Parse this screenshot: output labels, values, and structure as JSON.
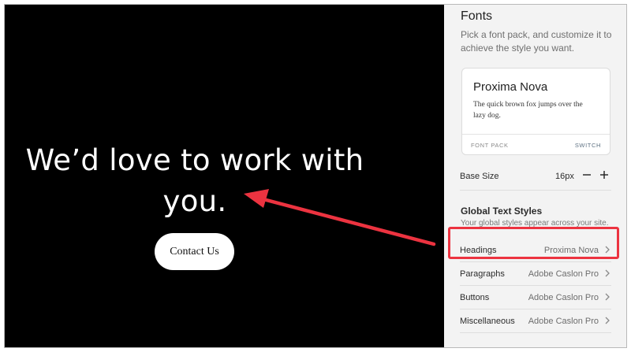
{
  "preview": {
    "heading_line1": "We’d love to work with",
    "heading_line2": "you.",
    "cta_label": "Contact Us"
  },
  "panel": {
    "title": "Fonts",
    "description": "Pick a font pack, and customize it to achieve the style you want.",
    "font_pack": {
      "name": "Proxima Nova",
      "sample": "The quick brown fox jumps over the lazy dog.",
      "label": "FONT PACK",
      "switch_label": "SWITCH"
    },
    "base_size": {
      "label": "Base Size",
      "value": "16px",
      "decrement_icon": "minus-icon",
      "increment_icon": "plus-icon"
    },
    "global_styles": {
      "title": "Global Text Styles",
      "subtitle": "Your global styles appear across your site.",
      "rows": [
        {
          "label": "Headings",
          "value": "Proxima Nova"
        },
        {
          "label": "Paragraphs",
          "value": "Adobe Caslon Pro"
        },
        {
          "label": "Buttons",
          "value": "Adobe Caslon Pro"
        },
        {
          "label": "Miscellaneous",
          "value": "Adobe Caslon Pro"
        }
      ]
    }
  },
  "annotation": {
    "color": "#ec3340",
    "highlighted_row": "Headings"
  }
}
